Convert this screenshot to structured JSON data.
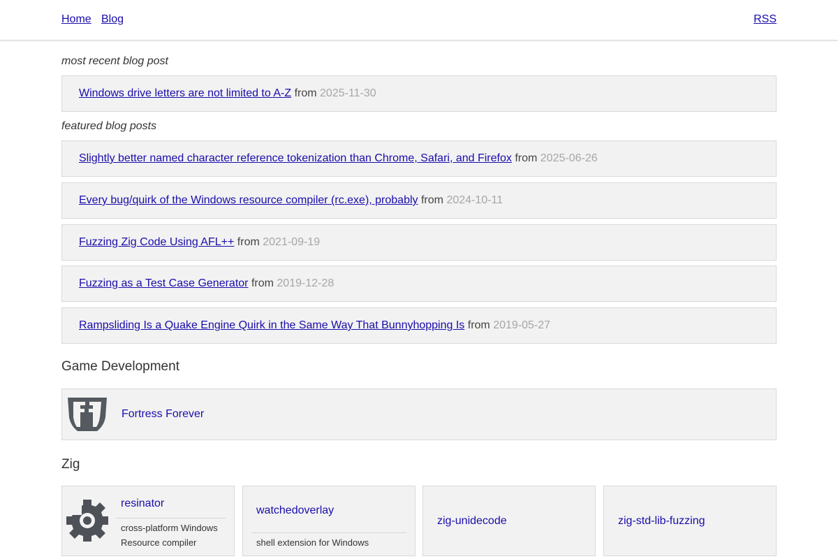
{
  "nav": {
    "home": "Home",
    "blog": "Blog",
    "rss": "RSS"
  },
  "recent": {
    "heading": "most recent blog post",
    "post": {
      "title": "Windows drive letters are not limited to A-Z",
      "from": "from",
      "date": "2025-11-30"
    }
  },
  "featured": {
    "heading": "featured blog posts",
    "posts": [
      {
        "title": "Slightly better named character reference tokenization than Chrome, Safari, and Firefox",
        "from": "from",
        "date": "2025-06-26"
      },
      {
        "title": "Every bug/quirk of the Windows resource compiler (rc.exe), probably",
        "from": "from",
        "date": "2024-10-11"
      },
      {
        "title": "Fuzzing Zig Code Using AFL++",
        "from": "from",
        "date": "2021-09-19"
      },
      {
        "title": "Fuzzing as a Test Case Generator",
        "from": "from",
        "date": "2019-12-28"
      },
      {
        "title": "Rampsliding Is a Quake Engine Quirk in the Same Way That Bunnyhopping Is",
        "from": "from",
        "date": "2019-05-27"
      }
    ]
  },
  "game_dev": {
    "heading": "Game Development",
    "project": {
      "name": "Fortress Forever",
      "icon": "fortress-forever-logo"
    }
  },
  "zig": {
    "heading": "Zig",
    "projects": [
      {
        "name": "resinator",
        "desc_line1": "cross-platform Windows",
        "desc_line2": "Resource compiler",
        "icon": "gear-icon"
      },
      {
        "name": "watchedoverlay",
        "desc": "shell extension for Windows"
      },
      {
        "name": "zig-unidecode"
      },
      {
        "name": "zig-std-lib-fuzzing"
      }
    ]
  },
  "colors": {
    "link": "#1a0dab",
    "date": "#a6a6a6",
    "box_bg": "#f2f2f2",
    "box_border": "#d9d9d9"
  }
}
